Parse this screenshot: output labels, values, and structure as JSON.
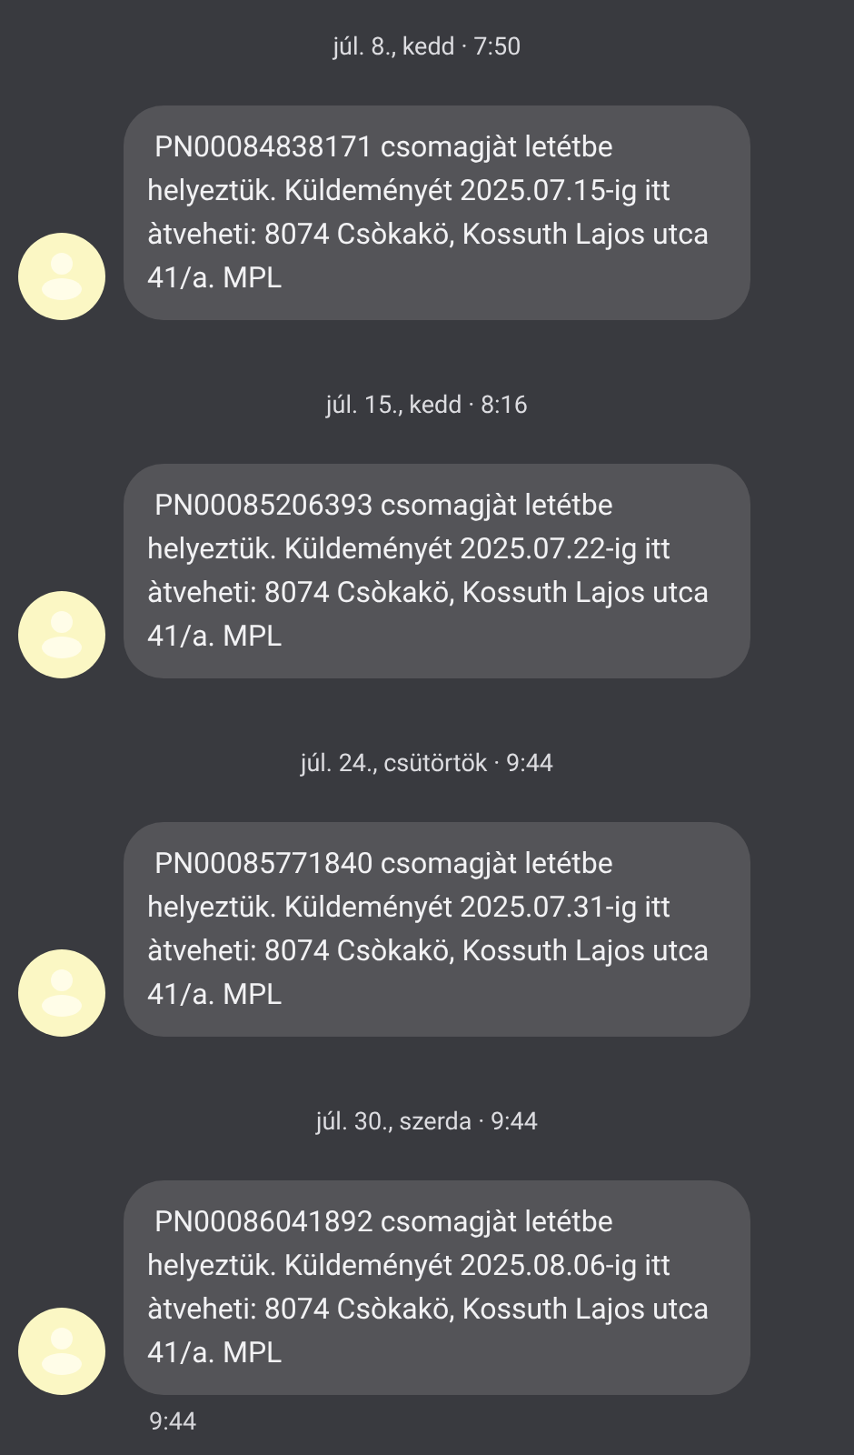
{
  "messages": [
    {
      "date": "júl. 8., kedd · 7:50",
      "text": " PN00084838171 csomagjàt letétbe helyeztük. Küldeményét 2025.07.15-ig itt àtveheti: 8074 Csòkakö, Kossuth Lajos utca 41/a. MPL"
    },
    {
      "date": "júl. 15., kedd · 8:16",
      "text": " PN00085206393 csomagjàt letétbe helyeztük. Küldeményét 2025.07.22-ig itt àtveheti: 8074 Csòkakö, Kossuth Lajos utca 41/a. MPL"
    },
    {
      "date": "júl. 24., csütörtök · 9:44",
      "text": " PN00085771840 csomagjàt letétbe helyeztük. Küldeményét 2025.07.31-ig itt àtveheti: 8074 Csòkakö, Kossuth Lajos utca 41/a. MPL"
    },
    {
      "date": "júl. 30., szerda · 9:44",
      "text": " PN00086041892 csomagjàt letétbe helyeztük. Küldeményét 2025.08.06-ig itt àtveheti: 8074 Csòkakö, Kossuth Lajos utca 41/a. MPL",
      "time": "9:44"
    }
  ]
}
